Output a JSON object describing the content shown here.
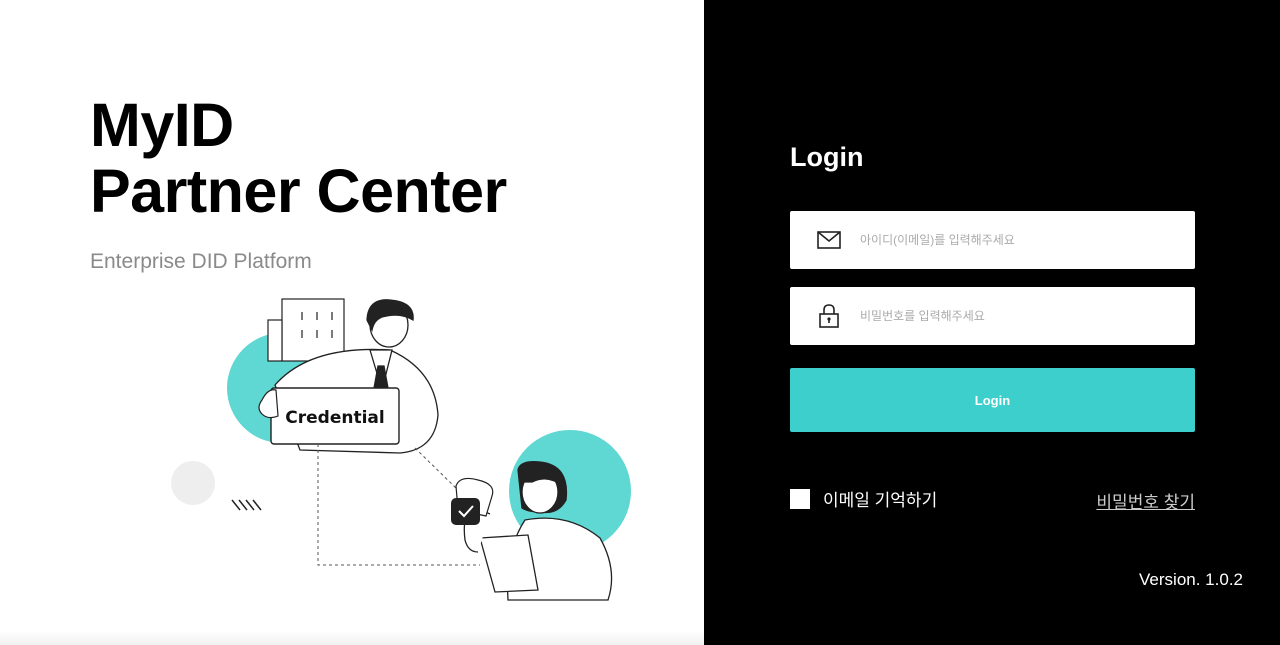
{
  "brand": {
    "title_line1": "MyID",
    "title_line2": "Partner Center",
    "subtitle": "Enterprise DID Platform",
    "credential_card": "Credential"
  },
  "login": {
    "title": "Login",
    "email_placeholder": "아이디(이메일)를 입력해주세요",
    "password_placeholder": "비밀번호를 입력해주세요",
    "button_label": "Login",
    "remember_label": "이메일 기억하기",
    "find_password_label": "비밀번호 찾기",
    "version": "Version. 1.0.2"
  },
  "colors": {
    "accent": "#3ccfcb",
    "panel": "#000000"
  },
  "icons": {
    "email": "mail-icon",
    "password": "lock-icon",
    "stamp": "check-icon"
  }
}
